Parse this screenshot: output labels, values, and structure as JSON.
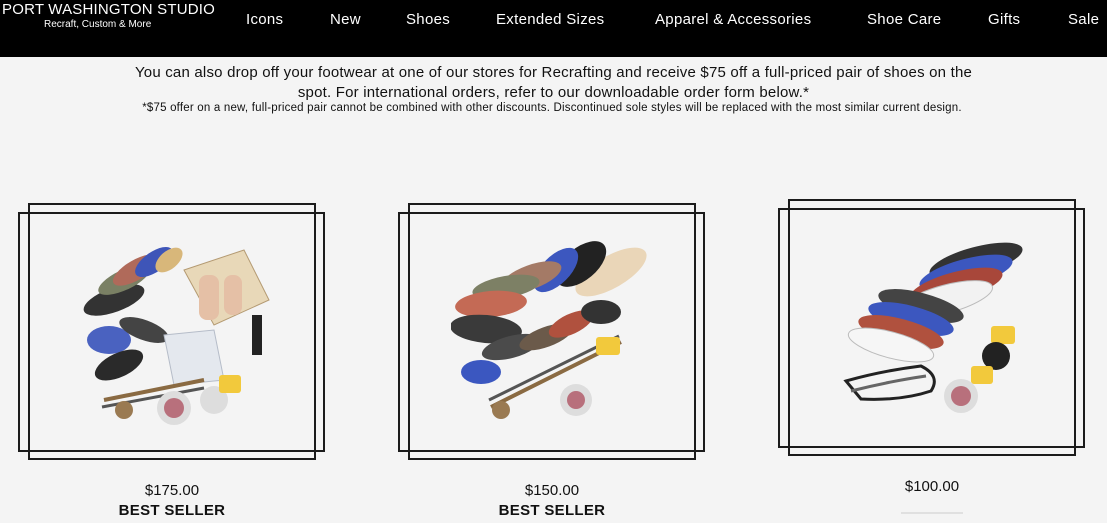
{
  "brand": {
    "title": "PORT WASHINGTON STUDIO",
    "subtitle": "Recraft, Custom & More"
  },
  "nav": {
    "items": [
      {
        "label": "Icons"
      },
      {
        "label": "New"
      },
      {
        "label": "Shoes"
      },
      {
        "label": "Extended Sizes"
      },
      {
        "label": "Apparel & Accessories"
      },
      {
        "label": "Shoe Care"
      },
      {
        "label": "Gifts"
      },
      {
        "label": "Sale"
      }
    ]
  },
  "intro": {
    "line1": "You can also drop off your footwear at one of our stores for Recrafting and receive $75 off a full-priced pair of shoes on the",
    "line2": "spot. For international orders, refer to our downloadable order form below.*",
    "note": "*$75 offer on a new, full-priced pair cannot be combined with other discounts. Discontinued sole styles will be replaced with the most similar current design."
  },
  "products": [
    {
      "price": "$175.00",
      "badge": "BEST SELLER",
      "image": "recraft-kit-full-image"
    },
    {
      "price": "$150.00",
      "badge": "BEST SELLER",
      "image": "recraft-kit-soles-image"
    },
    {
      "price": "$100.00",
      "badge": "",
      "image": "recraft-kit-sneaker-soles-image"
    }
  ],
  "colors": {
    "topbar": "#000000",
    "background": "#f4f4f4",
    "frame": "#1b1b1b"
  }
}
